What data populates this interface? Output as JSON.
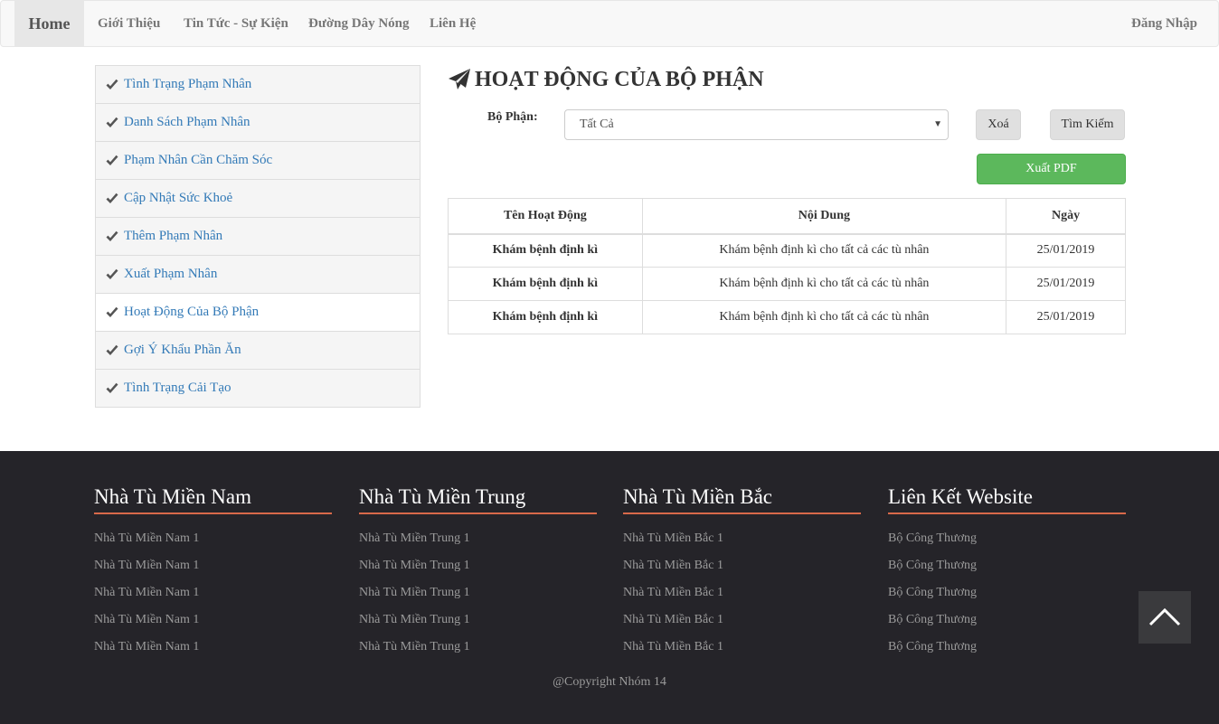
{
  "nav": {
    "home": "Home",
    "items": [
      "Giới Thiệu",
      "Tin Tức - Sự Kiện",
      "Đường Dây Nóng",
      "Liên Hệ"
    ],
    "login": "Đăng Nhập"
  },
  "sidebar": {
    "items": [
      {
        "label": "Tình Trạng Phạm Nhân"
      },
      {
        "label": "Danh Sách Phạm Nhân"
      },
      {
        "label": "Phạm Nhân Cần Chăm Sóc"
      },
      {
        "label": "Cập Nhật Sức Khoẻ"
      },
      {
        "label": "Thêm Phạm Nhân"
      },
      {
        "label": "Xuất Phạm Nhân"
      },
      {
        "label": "Hoạt Động Của Bộ Phận"
      },
      {
        "label": "Gợi Ý Khẩu Phần Ăn"
      },
      {
        "label": "Tình Trạng Cải Tạo"
      }
    ],
    "active_index": 6
  },
  "main": {
    "title": "HOẠT ĐỘNG CỦA BỘ PHẬN",
    "dept_label": "Bộ Phận:",
    "dept_selected": "Tất Cả",
    "delete_button": "Xoá",
    "search_button": "Tìm Kiếm",
    "pdf_button": "Xuất PDF",
    "table": {
      "headers": [
        "Tên Hoạt Động",
        "Nội Dung",
        "Ngày"
      ],
      "rows": [
        [
          "Khám bệnh định kì",
          "Khám bệnh định kì cho tất cả các tù nhân",
          "25/01/2019"
        ],
        [
          "Khám bệnh định kì",
          "Khám bệnh định kì cho tất cả các tù nhân",
          "25/01/2019"
        ],
        [
          "Khám bệnh định kì",
          "Khám bệnh định kì cho tất cả các tù nhân",
          "25/01/2019"
        ]
      ]
    }
  },
  "footer": {
    "columns": [
      {
        "heading": "Nhà Tù Miền Nam",
        "links": [
          "Nhà Tù Miền Nam 1",
          "Nhà Tù Miền Nam 1",
          "Nhà Tù Miền Nam 1",
          "Nhà Tù Miền Nam 1",
          "Nhà Tù Miền Nam 1"
        ]
      },
      {
        "heading": "Nhà Tù Miền Trung",
        "links": [
          "Nhà Tù Miền Trung 1",
          "Nhà Tù Miền Trung 1",
          "Nhà Tù Miền Trung 1",
          "Nhà Tù Miền Trung 1",
          "Nhà Tù Miền Trung 1"
        ]
      },
      {
        "heading": "Nhà Tù Miền Bắc",
        "links": [
          "Nhà Tù Miền Bắc 1",
          "Nhà Tù Miền Bắc 1",
          "Nhà Tù Miền Bắc 1",
          "Nhà Tù Miền Bắc 1",
          "Nhà Tù Miền Bắc 1"
        ]
      },
      {
        "heading": "Liên Kết Website",
        "links": [
          "Bộ Công Thương",
          "Bộ Công Thương",
          "Bộ Công Thương",
          "Bộ Công Thương",
          "Bộ Công Thương"
        ]
      }
    ],
    "copyright": "@Copyright Nhóm 14",
    "accent_color": "#d9694a"
  },
  "colors": {
    "link": "#337ab7",
    "success": "#5cb85c",
    "footer_bg": "#252429"
  }
}
